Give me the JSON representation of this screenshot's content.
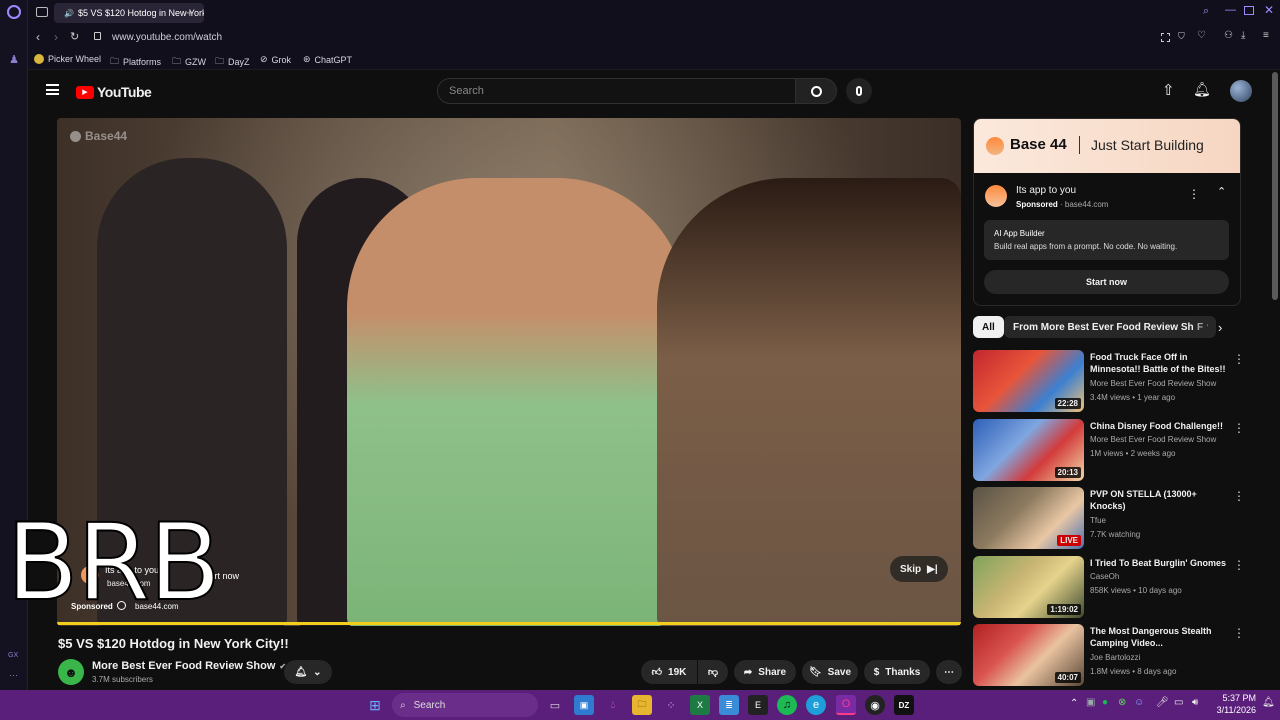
{
  "browser": {
    "tab_title": "$5 VS $120 Hotdog in New York City!!",
    "url": "www.youtube.com/watch",
    "bookmarks": [
      "Picker Wheel",
      "Platforms",
      "GZW",
      "DayZ",
      "Grok",
      "ChatGPT"
    ],
    "side_label": "GX"
  },
  "youtube": {
    "logo_text": "YouTube",
    "search_placeholder": "Search"
  },
  "video": {
    "overlay_brand": "Base44",
    "ad_overlay": {
      "title": "Its app to you",
      "cta": "Start now",
      "domain": "base44.com",
      "sponsored": "Sponsored"
    },
    "skip_label": "Skip",
    "brb_text": "BRB",
    "progress_fraction": 1.0,
    "title": "$5 VS $120 Hotdog in New York City!!",
    "channel": "More Best Ever Food Review Show",
    "subscribers": "3.7M subscribers",
    "likes": "19K",
    "share_label": "Share",
    "save_label": "Save",
    "thanks_label": "Thanks"
  },
  "ad_panel": {
    "banner_brand": "Base 44",
    "banner_tagline": "Just Start Building",
    "title": "Its app to you",
    "sponsored": "Sponsored",
    "domain": "base44.com",
    "feature_title": "AI App Builder",
    "feature_desc": "Build real apps from a prompt. No code. No waiting.",
    "cta": "Start now"
  },
  "chips": [
    "All",
    "From More Best Ever Food Review Show",
    "F"
  ],
  "recommendations": [
    {
      "title": "Food Truck Face Off in Minnesota!! Battle of the Bites!!",
      "channel": "More Best Ever Food Review Show",
      "meta": "3.4M views • 1 year ago",
      "duration": "22:28"
    },
    {
      "title": "China Disney Food Challenge!!",
      "channel": "More Best Ever Food Review Show",
      "meta": "1M views • 2 weeks ago",
      "duration": "20:13"
    },
    {
      "title": "PVP ON STELLA (13000+ Knocks)",
      "channel": "Tfue",
      "meta": "7.7K watching",
      "duration": "LIVE"
    },
    {
      "title": "I Tried To Beat Burglin' Gnomes",
      "channel": "CaseOh",
      "meta": "858K views • 10 days ago",
      "duration": "1:19:02"
    },
    {
      "title": "The Most Dangerous Stealth Camping Video...",
      "channel": "Joe Bartolozzi",
      "meta": "1.8M views • 8 days ago",
      "duration": "40:07"
    }
  ],
  "taskbar": {
    "search_placeholder": "Search",
    "time": "5:37 PM",
    "date": "3/11/2026"
  }
}
